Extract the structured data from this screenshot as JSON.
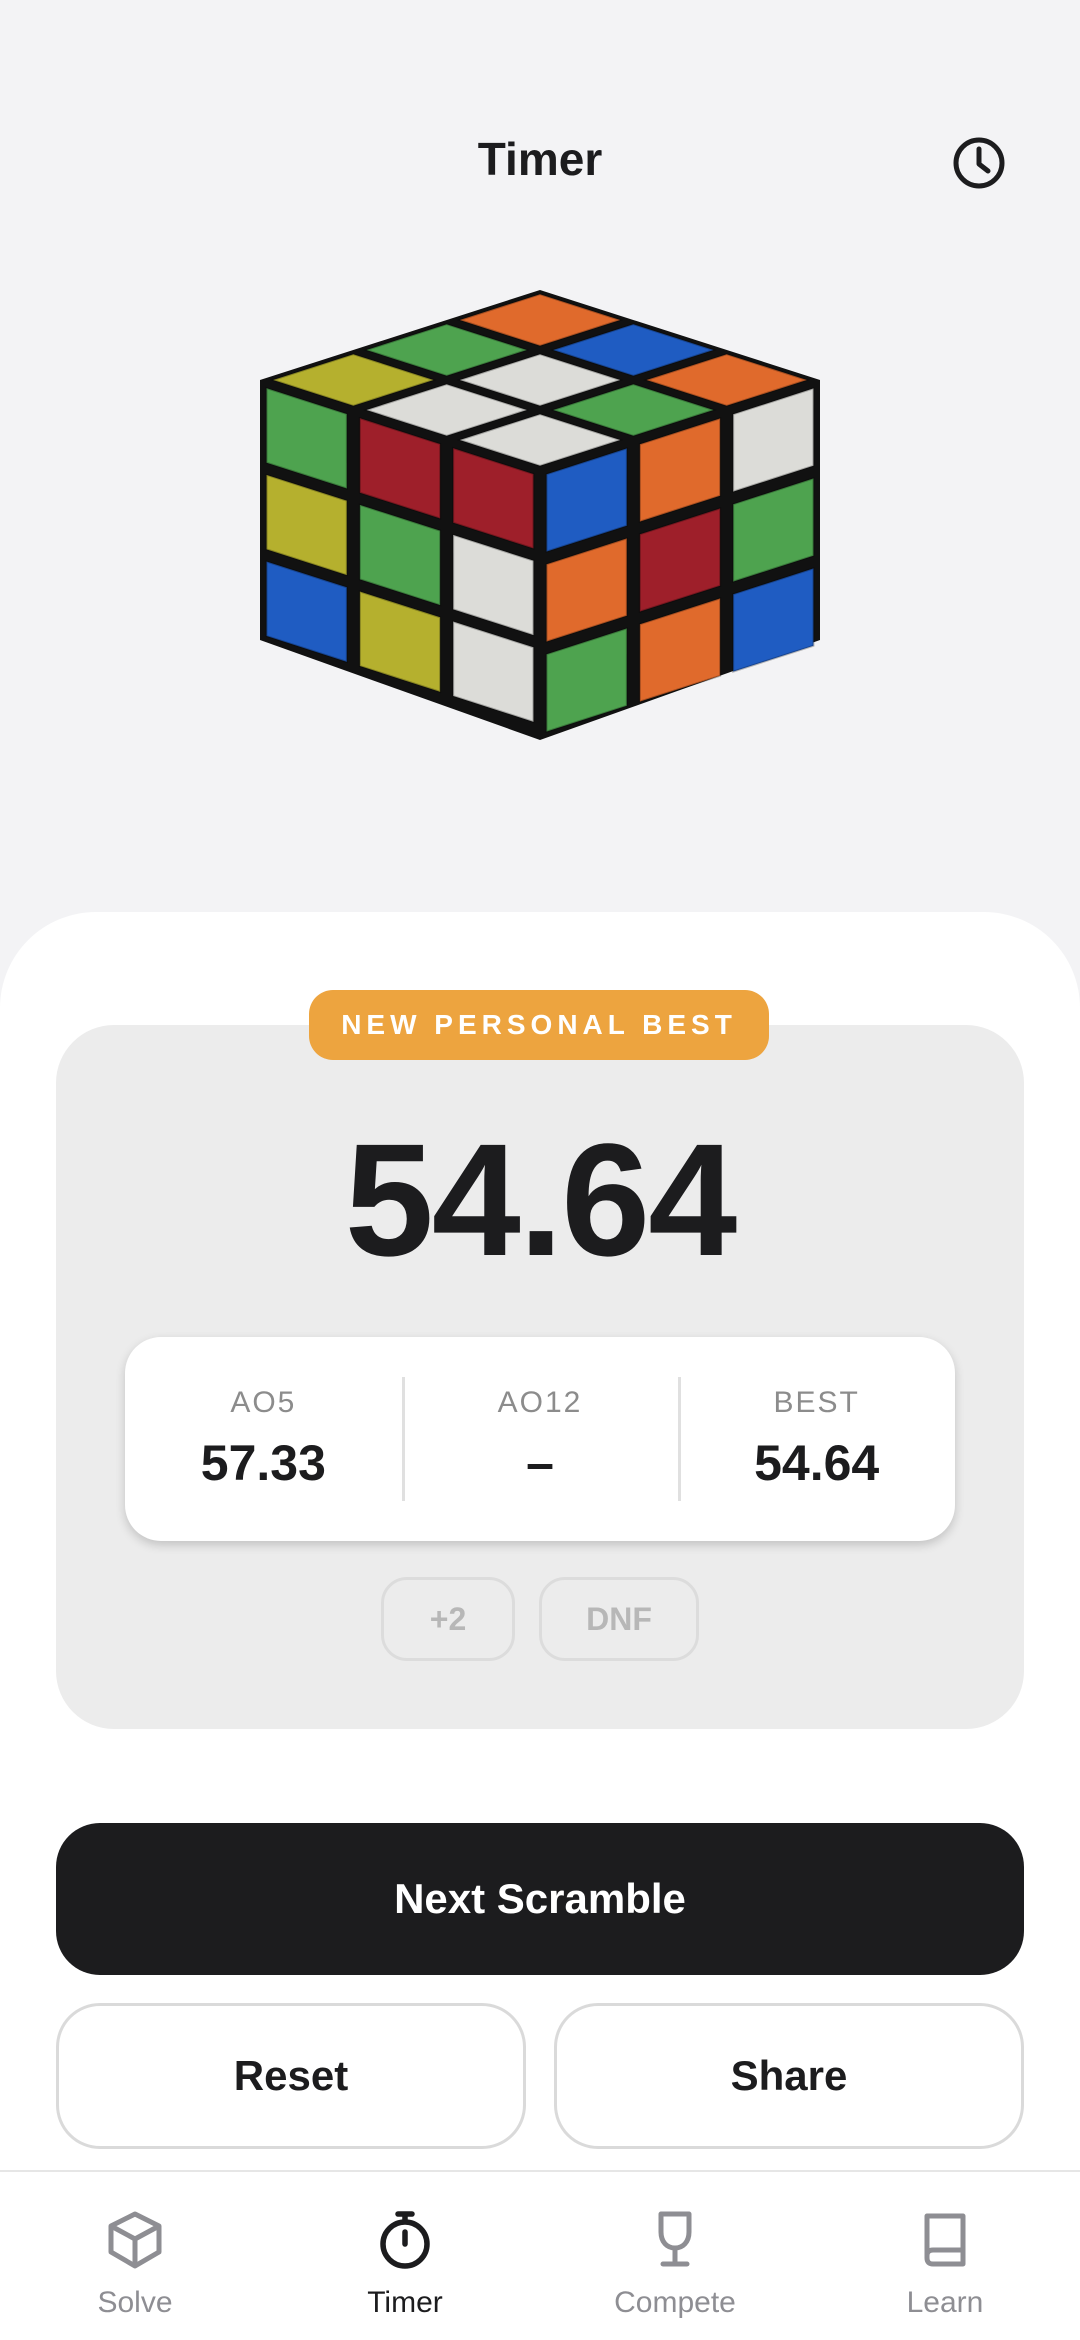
{
  "header": {
    "title": "Timer",
    "history_icon": "history-clock-icon"
  },
  "cube": {
    "icon": "rubiks-cube-illustration",
    "colors": {
      "green": "#4ea34f",
      "red": "#9e1f2a",
      "blue": "#1f5cc2",
      "orange": "#e06a2c",
      "white": "#dcdcd8",
      "yellow": "#b5b02e"
    }
  },
  "result": {
    "badge": "NEW PERSONAL BEST",
    "time": "54.64",
    "stats": [
      {
        "label": "AO5",
        "value": "57.33"
      },
      {
        "label": "AO12",
        "value": "–"
      },
      {
        "label": "BEST",
        "value": "54.64"
      }
    ],
    "penalties": {
      "plus_two": "+2",
      "dnf": "DNF"
    }
  },
  "actions": {
    "next_scramble": "Next Scramble",
    "reset": "Reset",
    "share": "Share"
  },
  "tabs": [
    {
      "label": "Solve",
      "icon": "cube-icon",
      "active": false
    },
    {
      "label": "Timer",
      "icon": "stopwatch-icon",
      "active": true
    },
    {
      "label": "Compete",
      "icon": "trophy-icon",
      "active": false
    },
    {
      "label": "Learn",
      "icon": "book-icon",
      "active": false
    }
  ],
  "theme": {
    "accent": "#eda43f",
    "primary": "#1c1c1e",
    "background": "#f3f3f5"
  }
}
